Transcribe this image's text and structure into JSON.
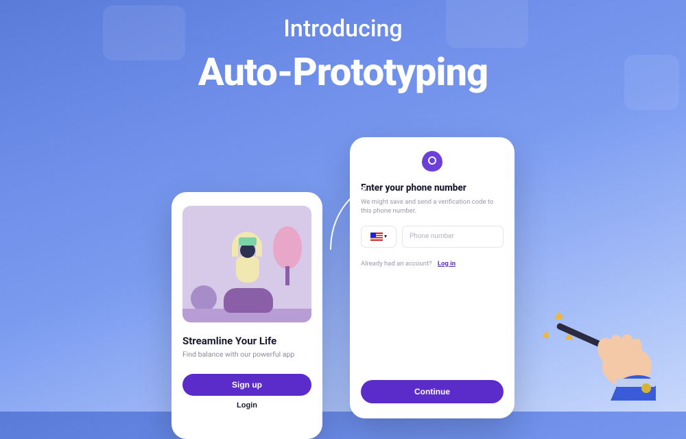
{
  "hero": {
    "intro": "Introducing",
    "title": "Auto-Prototyping"
  },
  "phone1": {
    "heading": "Streamline Your Life",
    "sub": "Find balance with our powerful app",
    "signup": "Sign up",
    "login": "Login"
  },
  "phone2": {
    "heading": "Enter your phone number",
    "sub": "We might save and send a verification code to this phone number.",
    "placeholder": "Phone number",
    "already": "Already had an account?",
    "login": "Log in",
    "continue": "Continue"
  },
  "colors": {
    "primary": "#5b2cc9"
  }
}
